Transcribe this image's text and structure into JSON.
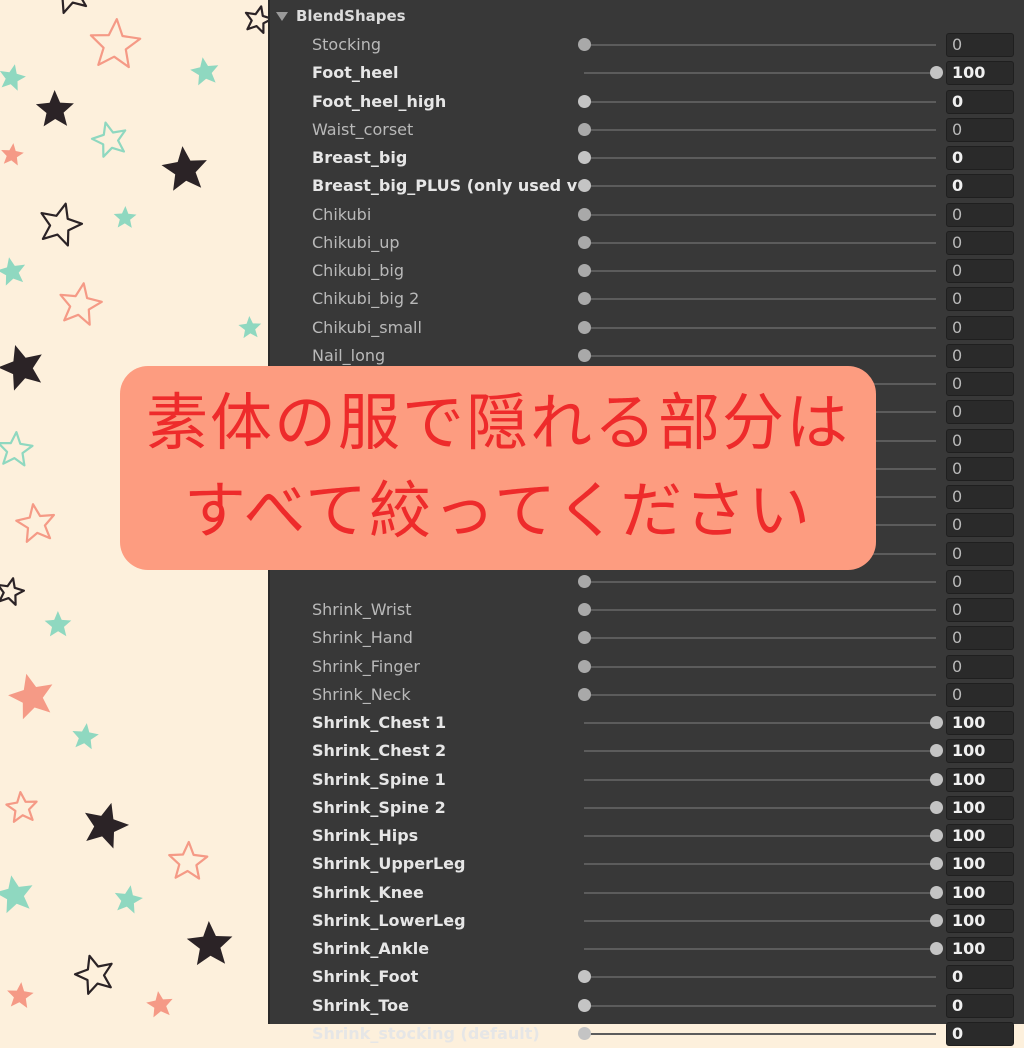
{
  "background": {
    "color": "#fdf0dc",
    "star_colors": [
      "#2b2326",
      "#f59a86",
      "#8fd8c0"
    ]
  },
  "panel": {
    "header": "BlendShapes",
    "rows": [
      {
        "name": "Stocking",
        "value": "0",
        "bold": false
      },
      {
        "name": "Foot_heel",
        "value": "100",
        "bold": true
      },
      {
        "name": "Foot_heel_high",
        "value": "0",
        "bold": true
      },
      {
        "name": "Waist_corset",
        "value": "0",
        "bold": false
      },
      {
        "name": "Breast_big",
        "value": "0",
        "bold": true
      },
      {
        "name": "Breast_big_PLUS (only used v",
        "value": "0",
        "bold": true
      },
      {
        "name": "Chikubi",
        "value": "0",
        "bold": false
      },
      {
        "name": "Chikubi_up",
        "value": "0",
        "bold": false
      },
      {
        "name": "Chikubi_big",
        "value": "0",
        "bold": false
      },
      {
        "name": "Chikubi_big 2",
        "value": "0",
        "bold": false
      },
      {
        "name": "Chikubi_small",
        "value": "0",
        "bold": false
      },
      {
        "name": "Nail_long",
        "value": "0",
        "bold": false
      },
      {
        "name": "",
        "value": "0",
        "bold": false
      },
      {
        "name": "",
        "value": "0",
        "bold": false
      },
      {
        "name": "",
        "value": "0",
        "bold": false
      },
      {
        "name": "",
        "value": "0",
        "bold": false
      },
      {
        "name": "",
        "value": "0",
        "bold": false
      },
      {
        "name": "",
        "value": "0",
        "bold": false
      },
      {
        "name": "",
        "value": "0",
        "bold": false
      },
      {
        "name": "",
        "value": "0",
        "bold": false
      },
      {
        "name": "Shrink_Wrist",
        "value": "0",
        "bold": false
      },
      {
        "name": "Shrink_Hand",
        "value": "0",
        "bold": false
      },
      {
        "name": "Shrink_Finger",
        "value": "0",
        "bold": false
      },
      {
        "name": "Shrink_Neck",
        "value": "0",
        "bold": false
      },
      {
        "name": "Shrink_Chest 1",
        "value": "100",
        "bold": true
      },
      {
        "name": "Shrink_Chest 2",
        "value": "100",
        "bold": true
      },
      {
        "name": "Shrink_Spine 1",
        "value": "100",
        "bold": true
      },
      {
        "name": "Shrink_Spine 2",
        "value": "100",
        "bold": true
      },
      {
        "name": "Shrink_Hips",
        "value": "100",
        "bold": true
      },
      {
        "name": "Shrink_UpperLeg",
        "value": "100",
        "bold": true
      },
      {
        "name": "Shrink_Knee",
        "value": "100",
        "bold": true
      },
      {
        "name": "Shrink_LowerLeg",
        "value": "100",
        "bold": true
      },
      {
        "name": "Shrink_Ankle",
        "value": "100",
        "bold": true
      },
      {
        "name": "Shrink_Foot",
        "value": "0",
        "bold": true
      },
      {
        "name": "Shrink_Toe",
        "value": "0",
        "bold": true
      },
      {
        "name": "Shrink_stocking (default)",
        "value": "0",
        "bold": true
      }
    ]
  },
  "callout": {
    "line1": "素体の服で隠れる部分は",
    "line2": "すべて絞ってください",
    "background_color": "#fd9c80",
    "text_color": "#ee2b2b"
  }
}
